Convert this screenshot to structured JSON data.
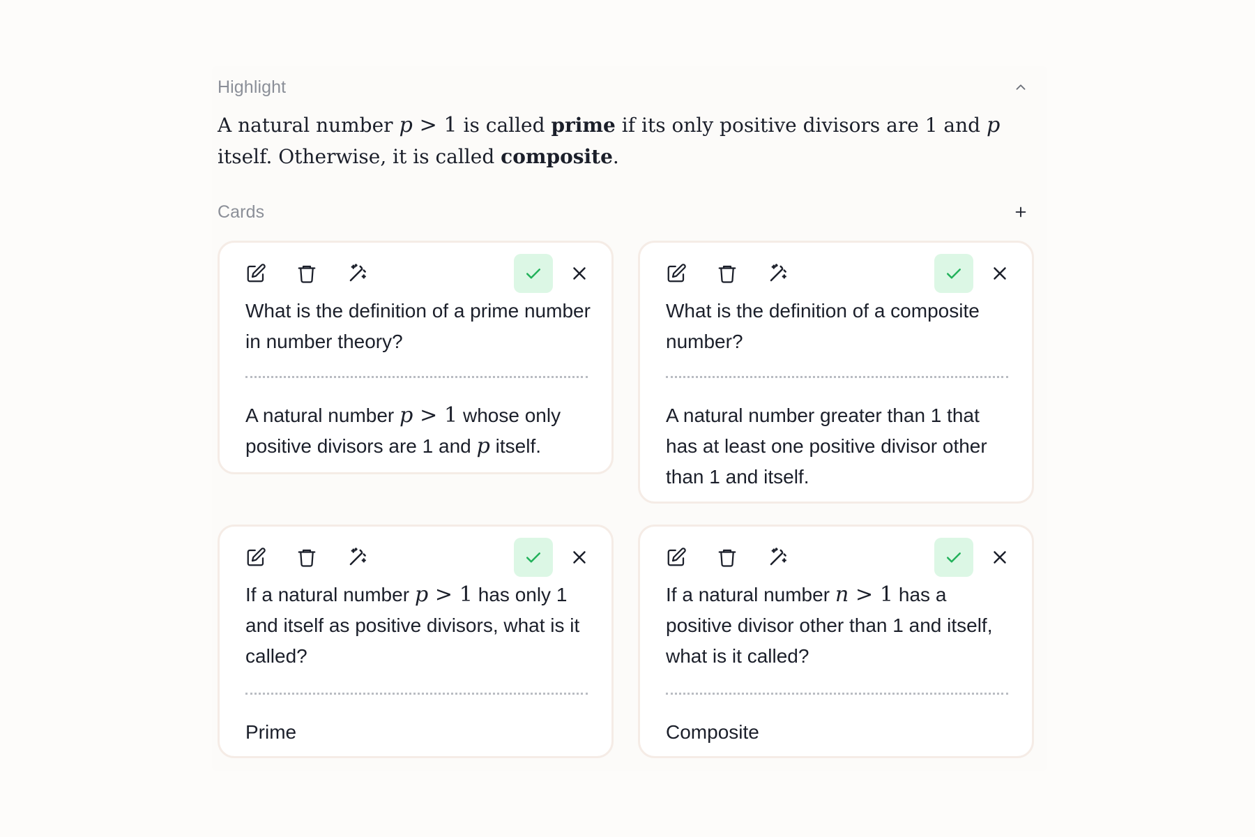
{
  "highlight": {
    "label": "Highlight",
    "text_prefix": "A natural number ",
    "math_var": "p",
    "math_op": " > ",
    "math_num": "1",
    "text_mid1": " is called ",
    "bold1": "prime",
    "text_mid2": " if its only positive divisors are 1 and ",
    "math_var2": "p",
    "text_mid3": " itself. Otherwise, it is called ",
    "bold2": "composite",
    "text_end": "."
  },
  "cards_section": {
    "label": "Cards"
  },
  "colors": {
    "accept_bg": "#dcf7e5",
    "accept_icon": "#22b15a",
    "card_border": "#f5ece6",
    "label_gray": "#8b8f98"
  },
  "cards": [
    {
      "question": "What is the definition of a prime number in number theory?",
      "answer_pre": "A natural number ",
      "answer_math_var": "p",
      "answer_math_op": " > ",
      "answer_math_num": "1",
      "answer_mid": " whose only positive divisors are 1 and ",
      "answer_math_var2": "p",
      "answer_end": " itself."
    },
    {
      "question": "What is the definition of a composite number?",
      "answer": "A natural number greater than 1 that has at least one positive divisor other than 1 and itself."
    },
    {
      "question_pre": "If a natural number ",
      "question_math_var": "p",
      "question_math_op": " > ",
      "question_math_num": "1",
      "question_end": " has only 1 and itself as positive divisors, what is it called?",
      "answer": "Prime"
    },
    {
      "question_pre": "If a natural number ",
      "question_math_var": "n",
      "question_math_op": " > ",
      "question_math_num": "1",
      "question_end": " has a positive divisor other than 1 and itself, what is it called?",
      "answer": "Composite"
    }
  ],
  "icons": {
    "collapse": "chevron-up-icon",
    "add": "plus-icon",
    "edit": "edit-icon",
    "delete": "trash-icon",
    "magic": "magic-wand-icon",
    "accept": "check-icon",
    "reject": "close-icon"
  }
}
